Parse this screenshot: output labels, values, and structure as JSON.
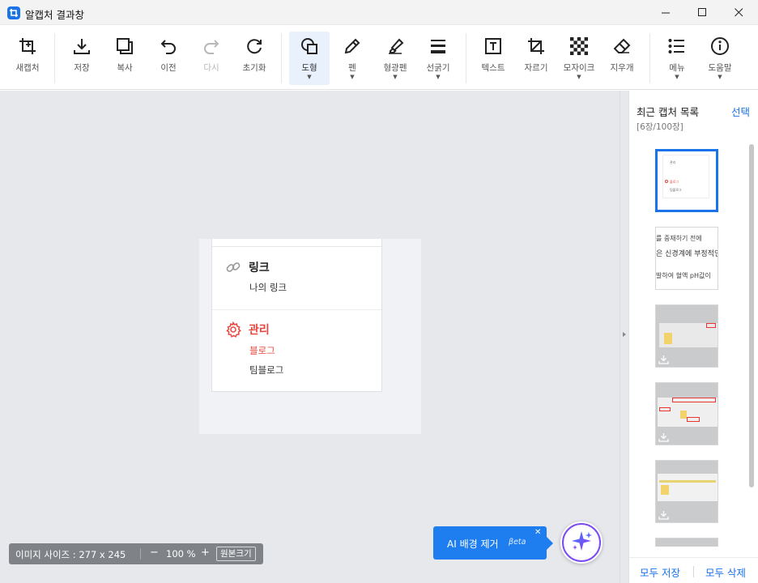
{
  "window": {
    "title": "알캡처 결과창",
    "icons": {
      "logo": "crop-logo-icon",
      "minimize": "minimize-icon",
      "maximize": "maximize-icon",
      "close": "close-icon"
    }
  },
  "toolbar": {
    "new_capture": "새캡처",
    "save": "저장",
    "copy": "복사",
    "undo": "이전",
    "redo": "다시",
    "reset": "초기화",
    "shape": "도형",
    "pen": "펜",
    "highlighter": "형광펜",
    "line_width": "선굵기",
    "text": "텍스트",
    "crop": "자르기",
    "mosaic": "모자이크",
    "eraser": "지우개",
    "menu": "메뉴",
    "help": "도움말",
    "active_tool": "shape",
    "accent_color": "#1a73e8"
  },
  "captured": {
    "link_heading": "링크",
    "link_item": "나의 링크",
    "manage_heading": "관리",
    "manage_item_1": "블로그",
    "manage_item_2": "팀블로그",
    "manage_color": "#e8463c"
  },
  "status": {
    "image_size": "이미지 사이즈 : 277 x 245",
    "zoom_out": "−",
    "zoom": "100 %",
    "zoom_in": "+",
    "original_size": "원본크기"
  },
  "ai": {
    "label": "AI 배경 제거",
    "beta": "βeta",
    "close": "✕"
  },
  "panel": {
    "title": "최근 캡처 목록",
    "select": "선택",
    "count": "[6장/100장]",
    "save_all": "모두 저장",
    "delete_all": "모두 삭제",
    "thumb1_lines": [
      "블로그",
      "팀블로그",
      "관리"
    ],
    "thumb2_lines": [
      "를 중재하기 전에",
      "은 신경계에 부정적인",
      "발하여 혈액 pH값이"
    ]
  }
}
